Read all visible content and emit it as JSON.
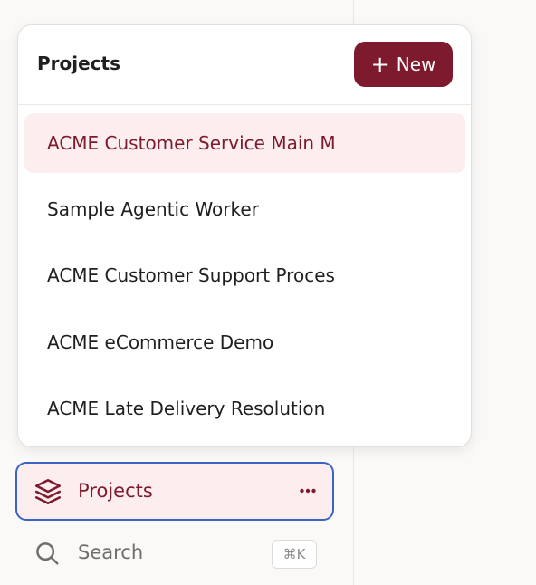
{
  "colors": {
    "accent": "#7d1a2e",
    "active_bg": "#fceeee",
    "focus_ring": "#3b63c4",
    "text": "#1f1f1f",
    "muted": "#6e6e6e"
  },
  "popover": {
    "title": "Projects",
    "new_button": {
      "icon": "plus-icon",
      "label": "New"
    },
    "projects": [
      {
        "label": "ACME Customer Service Main M",
        "active": true
      },
      {
        "label": "Sample Agentic Worker",
        "active": false
      },
      {
        "label": "ACME Customer Support Proces",
        "active": false
      },
      {
        "label": "ACME eCommerce Demo",
        "active": false
      },
      {
        "label": "ACME Late Delivery Resolution",
        "active": false
      }
    ]
  },
  "sidebar": {
    "projects_item": {
      "icon": "layers-icon",
      "label": "Projects",
      "more_icon": "more-horizontal-icon"
    },
    "search_item": {
      "icon": "search-icon",
      "label": "Search",
      "shortcut": "⌘K"
    }
  }
}
